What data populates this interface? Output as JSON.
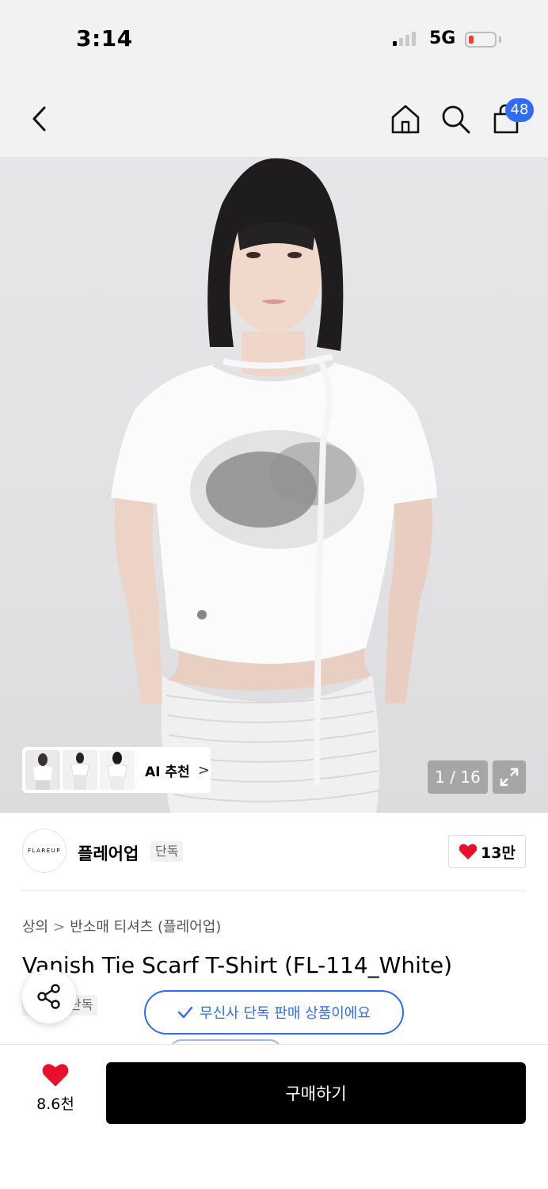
{
  "status": {
    "time": "3:14",
    "network": "5G"
  },
  "nav": {
    "cart_count": "48",
    "icons": [
      "chevron-left-icon",
      "home-icon",
      "search-icon",
      "shopping-bag-icon"
    ]
  },
  "gallery": {
    "ai_label": "AI 추천",
    "ai_chevron": ">",
    "counter": "1 / 16"
  },
  "brand": {
    "logo_text": "FLAREUP",
    "name": "플레어업",
    "exclusive": "단독",
    "likes": "13만"
  },
  "product": {
    "breadcrumb": [
      "상의",
      "반소매 티셔츠 (플레어업)"
    ],
    "breadcrumb_sep": ">",
    "title": "Vanish Tie Scarf T-Shirt (FL-114_White)",
    "exclusive_badge": "단독"
  },
  "toast": {
    "text": "무신사 단독 판매 상품이에요"
  },
  "bottom": {
    "wish_count": "8.6천",
    "buy_label": "구매하기"
  },
  "colors": {
    "accent": "#2f6cf6",
    "heart": "#e8102a",
    "buy": "#000000"
  }
}
